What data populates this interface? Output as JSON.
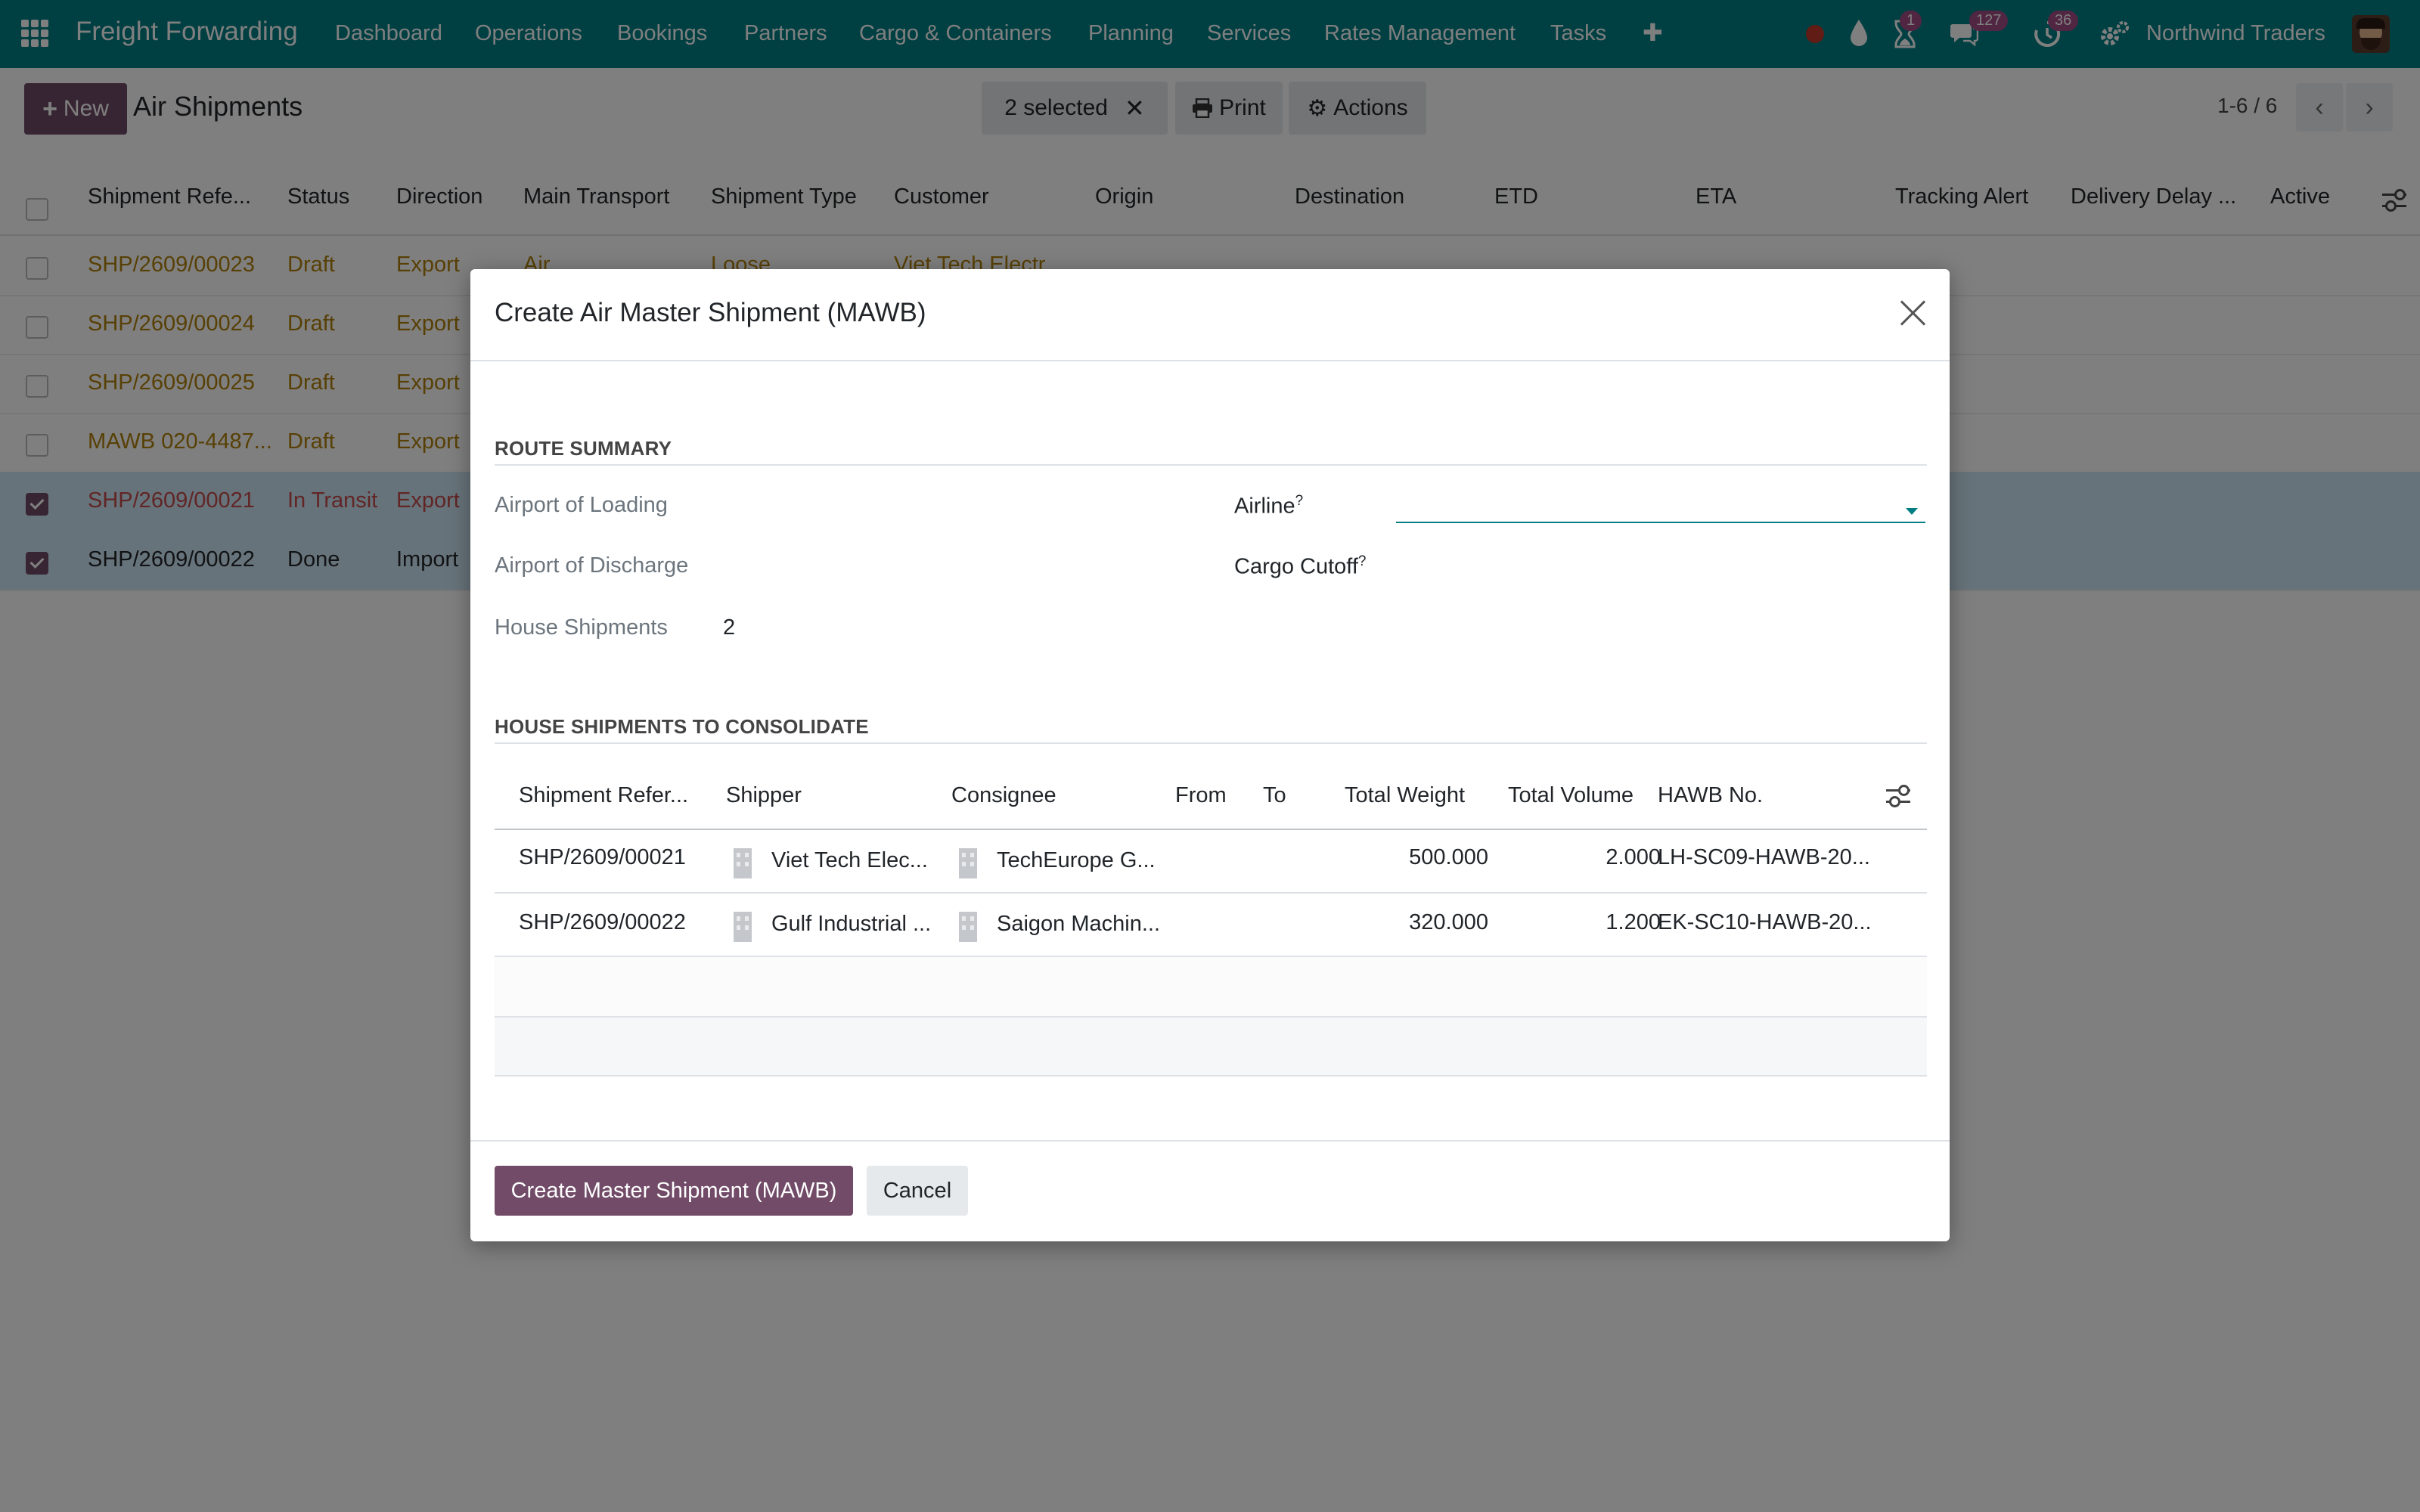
{
  "navbar": {
    "brand": "Freight Forwarding",
    "menu": [
      "Dashboard",
      "Operations",
      "Bookings",
      "Partners",
      "Cargo & Containers",
      "Planning",
      "Services",
      "Rates Management",
      "Tasks"
    ],
    "plus": "✚",
    "badges": {
      "activity": "1",
      "messages": "127",
      "updates": "36"
    },
    "company": "Northwind Traders",
    "colors": {
      "bar": "#017e84",
      "badge": "#a34d85"
    }
  },
  "control": {
    "new_label": "New",
    "title": "Air Shipments",
    "selected": "2 selected",
    "print": "Print",
    "actions": "Actions",
    "pager": "1-6 / 6"
  },
  "list": {
    "headers": [
      "Shipment Refe...",
      "Status",
      "Direction",
      "Main Transport",
      "Shipment Type",
      "Customer",
      "Origin",
      "Destination",
      "ETD",
      "ETA",
      "Tracking Alert",
      "Delivery Delay ...",
      "Active"
    ],
    "rows": [
      {
        "ref": "SHP/2609/00023",
        "status": "Draft",
        "direction": "Export",
        "transport": "Air",
        "type": "Loose",
        "customer": "Viet Tech Electr..."
      },
      {
        "ref": "SHP/2609/00024",
        "status": "Draft",
        "direction": "Export"
      },
      {
        "ref": "SHP/2609/00025",
        "status": "Draft",
        "direction": "Export"
      },
      {
        "ref": "MAWB 020-4487...",
        "status": "Draft",
        "direction": "Export"
      },
      {
        "ref": "SHP/2609/00021",
        "status": "In Transit",
        "direction": "Export"
      },
      {
        "ref": "SHP/2609/00022",
        "status": "Done",
        "direction": "Import"
      }
    ]
  },
  "modal": {
    "title": "Create Air Master Shipment (MAWB)",
    "route_summary": "ROUTE SUMMARY",
    "airport_loading": "Airport of Loading",
    "airport_discharge": "Airport of Discharge",
    "house_shipments_label": "House Shipments",
    "house_shipments_value": "2",
    "airline": "Airline",
    "cargo_cutoff": "Cargo Cutoff",
    "help_mark": "?",
    "consolidate_title": "HOUSE SHIPMENTS TO CONSOLIDATE",
    "sub_headers": [
      "Shipment Refer...",
      "Shipper",
      "Consignee",
      "From",
      "To",
      "Total Weight",
      "Total Volume",
      "HAWB No."
    ],
    "sub_rows": [
      {
        "ref": "SHP/2609/00021",
        "shipper": "Viet Tech Elec...",
        "consignee": "TechEurope G...",
        "weight": "500.000",
        "volume": "2.000",
        "hawb": "LH-SC09-HAWB-20..."
      },
      {
        "ref": "SHP/2609/00022",
        "shipper": "Gulf Industrial ...",
        "consignee": "Saigon Machin...",
        "weight": "320.000",
        "volume": "1.200",
        "hawb": "EK-SC10-HAWB-20..."
      }
    ],
    "create_button": "Create Master Shipment (MAWB)",
    "cancel_button": "Cancel"
  }
}
